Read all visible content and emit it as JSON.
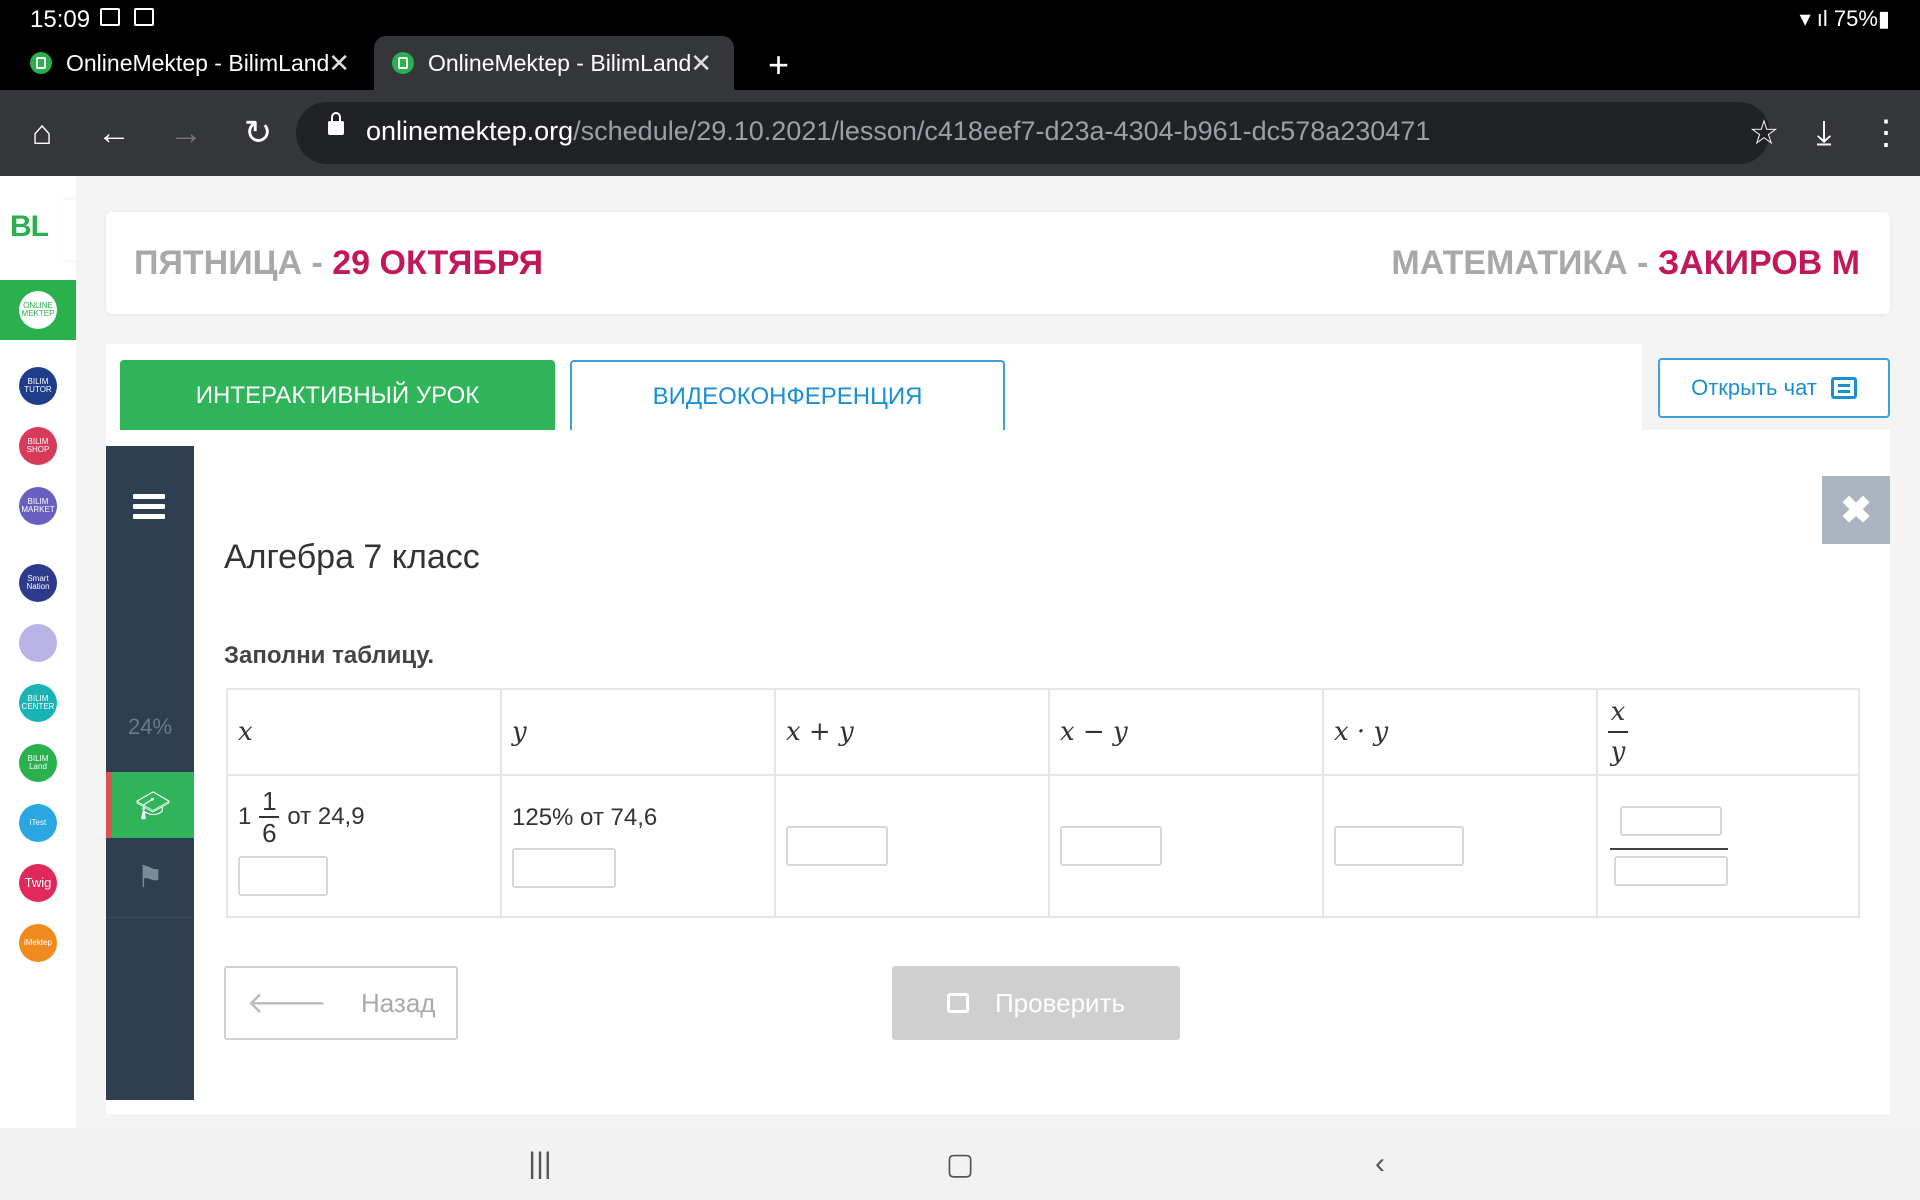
{
  "status_bar": {
    "time": "15:09",
    "battery": "75%"
  },
  "browser": {
    "tabs": [
      {
        "title": "OnlineMektep - BilimLand"
      },
      {
        "title": "OnlineMektep - BilimLand"
      }
    ],
    "new_tab_glyph": "+",
    "url_domain": "onlinemektep.org",
    "url_path": "/schedule/29.10.2021/lesson/c418eef7-d23a-4304-b961-dc578a230471"
  },
  "rail": {
    "logo": "BL",
    "toggle_glyph": "›",
    "items": [
      {
        "label": "ONLINE MEKTEP",
        "color": "#ffffff"
      },
      {
        "label": "BILIM TUTOR",
        "color": "#1f3d8a"
      },
      {
        "label": "BILIM SHOP",
        "color": "#d83a5a"
      },
      {
        "label": "BILIM MARKET",
        "color": "#6a5fc1"
      },
      {
        "label": "Smart Nation",
        "color": "#2e3a8c"
      },
      {
        "label": "",
        "color": "#b9b3e6"
      },
      {
        "label": "BILIM CENTER",
        "color": "#19b3b3"
      },
      {
        "label": "BILIM Land",
        "color": "#2bb04e"
      },
      {
        "label": "iTest",
        "color": "#2aa7e0"
      },
      {
        "label": "Twig",
        "color": "#e0285a"
      },
      {
        "label": "iMektep",
        "color": "#f08a1c"
      }
    ]
  },
  "header": {
    "day": "ПЯТНИЦА",
    "sep": " - ",
    "date": "29 ОКТЯБРЯ",
    "subject": "МАТЕМАТИКА",
    "teacher": "ЗАКИРОВ М"
  },
  "lesson_tabs": {
    "interactive": "ИНТЕРАКТИВНЫЙ УРОК",
    "video": "ВИДЕОКОНФЕРЕНЦИЯ"
  },
  "open_chat": "Открыть чат",
  "lesson": {
    "progress": "24%",
    "title": "Алгебра 7 класс",
    "instruction": "Заполни таблицу.",
    "table": {
      "headers": [
        "x",
        "y",
        "x + y",
        "x − y",
        "x · y"
      ],
      "frac_header": {
        "num": "x",
        "den": "y"
      },
      "x_whole": "1",
      "x_num": "1",
      "x_den": "6",
      "x_tail": "от 24,9",
      "y_cell": "125% от 74,6"
    },
    "back": "Назад",
    "check": "Проверить"
  },
  "colors": {
    "brand_green": "#2fb45a",
    "accent": "#c2185b",
    "sidebar_dark": "#2d3e50",
    "link_blue": "#1a8fd1"
  }
}
